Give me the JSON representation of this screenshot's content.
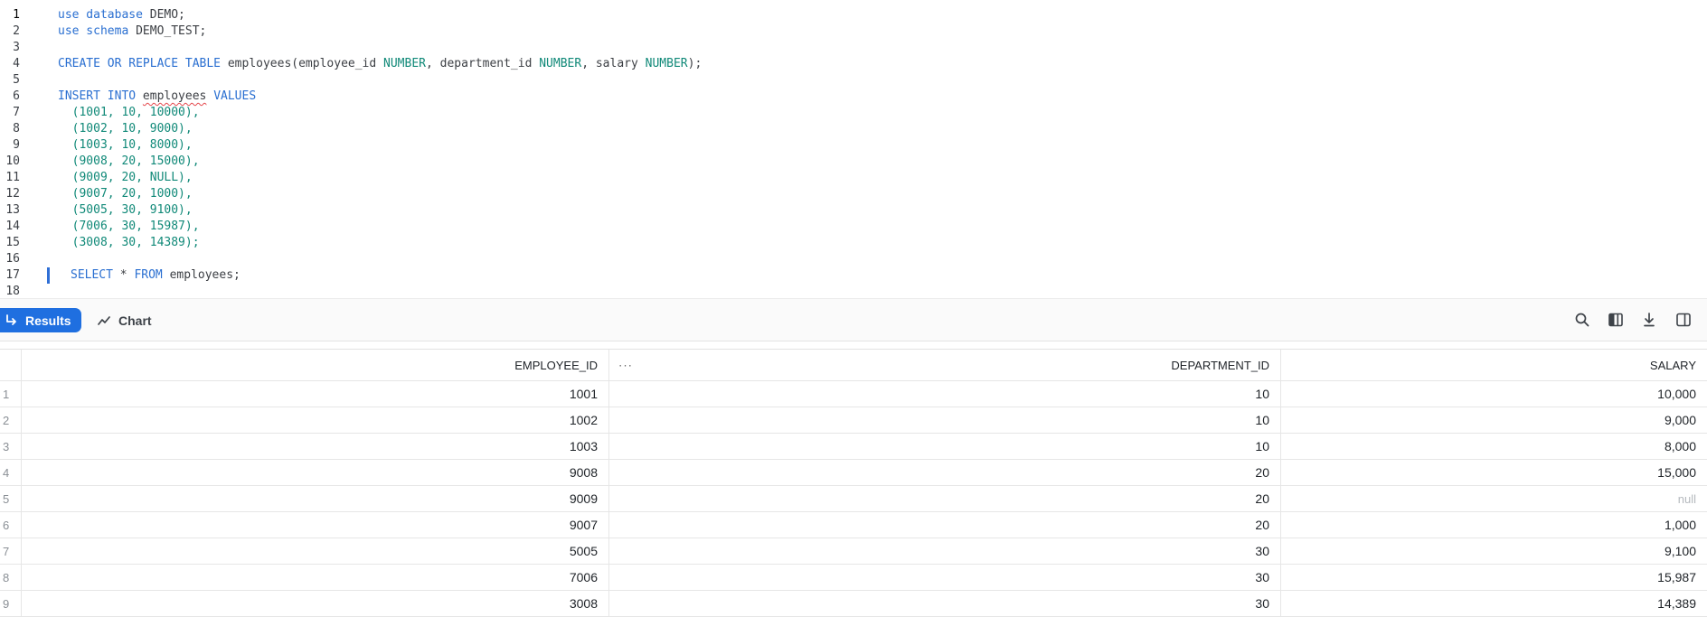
{
  "editor": {
    "lines": [
      {
        "no": "1",
        "tokens": [
          {
            "t": "use database ",
            "c": "kw"
          },
          {
            "t": "DEMO;",
            "c": "pl"
          }
        ]
      },
      {
        "no": "2",
        "tokens": [
          {
            "t": "use schema ",
            "c": "kw"
          },
          {
            "t": "DEMO_TEST;",
            "c": "pl"
          }
        ]
      },
      {
        "no": "3",
        "tokens": []
      },
      {
        "no": "4",
        "tokens": [
          {
            "t": "CREATE OR REPLACE TABLE ",
            "c": "kw"
          },
          {
            "t": "employees(employee_id ",
            "c": "pl"
          },
          {
            "t": "NUMBER",
            "c": "tp"
          },
          {
            "t": ", department_id ",
            "c": "pl"
          },
          {
            "t": "NUMBER",
            "c": "tp"
          },
          {
            "t": ", salary ",
            "c": "pl"
          },
          {
            "t": "NUMBER",
            "c": "tp"
          },
          {
            "t": ");",
            "c": "pl"
          }
        ]
      },
      {
        "no": "5",
        "tokens": []
      },
      {
        "no": "6",
        "tokens": [
          {
            "t": "INSERT INTO ",
            "c": "kw"
          },
          {
            "t": "employees",
            "c": "pl squiggle"
          },
          {
            "t": " VALUES",
            "c": "kw"
          }
        ]
      },
      {
        "no": "7",
        "tokens": [
          {
            "t": "  (1001, 10, 10000),",
            "c": "nm"
          }
        ]
      },
      {
        "no": "8",
        "tokens": [
          {
            "t": "  (1002, 10, 9000),",
            "c": "nm"
          }
        ]
      },
      {
        "no": "9",
        "tokens": [
          {
            "t": "  (1003, 10, 8000),",
            "c": "nm"
          }
        ]
      },
      {
        "no": "10",
        "tokens": [
          {
            "t": "  (9008, 20, 15000),",
            "c": "nm"
          }
        ]
      },
      {
        "no": "11",
        "tokens": [
          {
            "t": "  (9009, 20, NULL),",
            "c": "nm"
          }
        ]
      },
      {
        "no": "12",
        "tokens": [
          {
            "t": "  (9007, 20, 1000),",
            "c": "nm"
          }
        ]
      },
      {
        "no": "13",
        "tokens": [
          {
            "t": "  (5005, 30, 9100),",
            "c": "nm"
          }
        ]
      },
      {
        "no": "14",
        "tokens": [
          {
            "t": "  (7006, 30, 15987),",
            "c": "nm"
          }
        ]
      },
      {
        "no": "15",
        "tokens": [
          {
            "t": "  (3008, 30, 14389);",
            "c": "nm"
          }
        ]
      },
      {
        "no": "16",
        "tokens": []
      },
      {
        "no": "17",
        "cursor": true,
        "tokens": [
          {
            "t": "SELECT ",
            "c": "kw"
          },
          {
            "t": "* ",
            "c": "pl"
          },
          {
            "t": "FROM ",
            "c": "kw"
          },
          {
            "t": "employees;",
            "c": "pl"
          }
        ]
      },
      {
        "no": "18",
        "tokens": []
      }
    ]
  },
  "toolbar": {
    "results_label": "Results",
    "chart_label": "Chart",
    "icons": [
      "search-icon",
      "columns-icon",
      "download-icon",
      "panel-toggle-icon"
    ]
  },
  "grid": {
    "columns": [
      "EMPLOYEE_ID",
      "DEPARTMENT_ID",
      "SALARY"
    ],
    "column_menu": "···",
    "rows": [
      {
        "idx": "1",
        "cells": [
          "1001",
          "10",
          "10,000"
        ]
      },
      {
        "idx": "2",
        "cells": [
          "1002",
          "10",
          "9,000"
        ]
      },
      {
        "idx": "3",
        "cells": [
          "1003",
          "10",
          "8,000"
        ]
      },
      {
        "idx": "4",
        "cells": [
          "9008",
          "20",
          "15,000"
        ]
      },
      {
        "idx": "5",
        "cells": [
          "9009",
          "20",
          "null"
        ]
      },
      {
        "idx": "6",
        "cells": [
          "9007",
          "20",
          "1,000"
        ]
      },
      {
        "idx": "7",
        "cells": [
          "5005",
          "30",
          "9,100"
        ]
      },
      {
        "idx": "8",
        "cells": [
          "7006",
          "30",
          "15,987"
        ]
      },
      {
        "idx": "9",
        "cells": [
          "3008",
          "30",
          "14,389"
        ]
      }
    ]
  },
  "colors": {
    "accent": "#1f6fe0",
    "keyword": "#2a6fd1",
    "type_number": "#108978",
    "null_text": "#b5b9be"
  }
}
